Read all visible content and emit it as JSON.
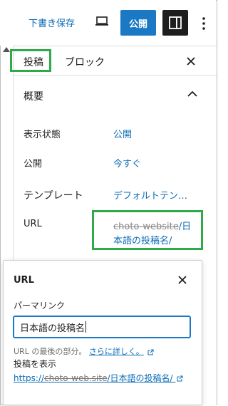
{
  "toolbar": {
    "draft_label": "下書き保存",
    "publish_label": "公開"
  },
  "sidebar": {
    "tabs": [
      {
        "label": "投稿"
      },
      {
        "label": "ブロック"
      }
    ],
    "section_title": "概要",
    "rows": {
      "visibility": {
        "label": "表示状態",
        "value": "公開"
      },
      "publish": {
        "label": "公開",
        "value": "今すぐ"
      },
      "template": {
        "label": "テンプレート",
        "value": "デフォルトテン…"
      },
      "url": {
        "label": "URL",
        "value_line1_blur": "choto-website",
        "value_line1_tail": "/日",
        "value_line2": "本語の投稿名/"
      }
    }
  },
  "popover": {
    "title": "URL",
    "field_label": "パーマリンク",
    "input_value": "日本語の投稿名",
    "help_text": "URL の最後の部分。",
    "help_link": "さらに詳しく。",
    "view_label": "投稿を表示",
    "view_link_prefix": "https://",
    "view_link_blur": "choto-web.site",
    "view_link_tail": "/日本語の投稿名/"
  },
  "colors": {
    "accent": "#1b78c4",
    "link": "#0a6cb5",
    "highlight": "#2eaa4a",
    "dark_button": "#1e1e1e"
  },
  "icons": [
    "preview-device-icon",
    "settings-panel-icon",
    "more-options-icon",
    "close-icon",
    "chevron-up-icon",
    "external-link-icon"
  ]
}
